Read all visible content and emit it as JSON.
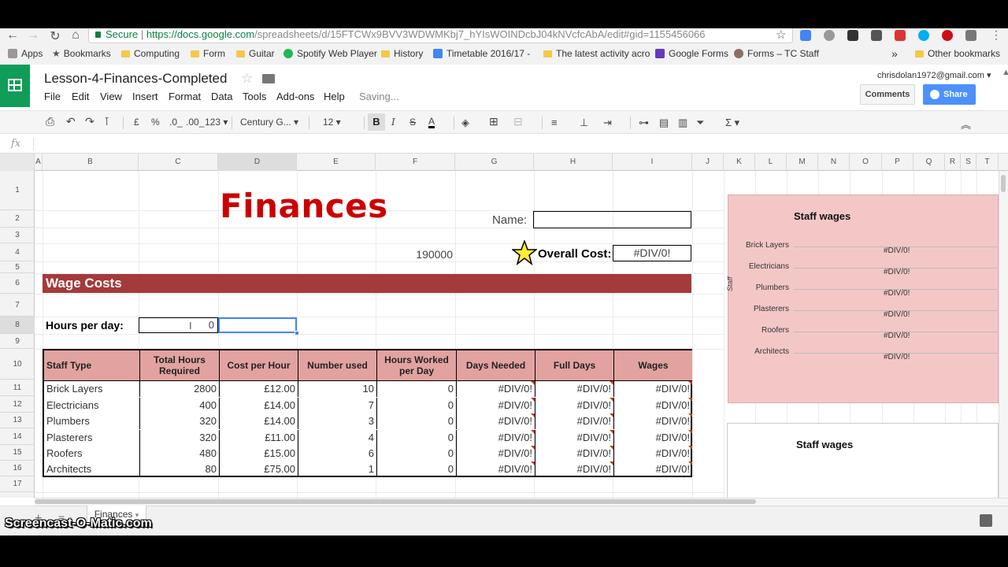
{
  "browser": {
    "secure_label": "Secure",
    "url_host": "https://docs.google.com",
    "url_path": "/spreadsheets/d/15FTCWx9BVV3WDWMKbj7_hYIsWOINDcbJ04kNVcfcAbA/edit#gid=1155456066",
    "bookmarks": [
      "Apps",
      "Bookmarks",
      "Computing",
      "Form",
      "Guitar",
      "Spotify Web Player",
      "History",
      "Timetable 2016/17 - ",
      "The latest activity acro",
      "Google Forms",
      "Forms – TC Staff",
      "Other bookmarks"
    ],
    "overflow": "»"
  },
  "doc": {
    "title": "Lesson-4-Finances-Completed",
    "account": "chrisdolan1972@gmail.com ▾",
    "comments": "Comments",
    "share": "Share",
    "saving": "Saving...",
    "menu": [
      "File",
      "Edit",
      "View",
      "Insert",
      "Format",
      "Data",
      "Tools",
      "Add-ons",
      "Help"
    ]
  },
  "toolbar": {
    "currency": "£",
    "percent": "%",
    "dec_less": ".0_",
    "dec_more": ".00_",
    "format": "123 ▾",
    "font": "Century G... ▾",
    "size": "12 ▾",
    "bold": "B",
    "italic": "I",
    "strike": "S",
    "textcolor": "A",
    "sigma": "Σ ▾"
  },
  "formula_bar": {
    "fx": "fx"
  },
  "columns": [
    "A",
    "B",
    "C",
    "D",
    "E",
    "F",
    "G",
    "H",
    "I",
    "J",
    "K",
    "L",
    "M",
    "N",
    "O",
    "P",
    "Q",
    "R",
    "S",
    "T"
  ],
  "rows": [
    "1",
    "2",
    "3",
    "4",
    "5",
    "6",
    "7",
    "8",
    "9",
    "10",
    "11",
    "12",
    "13",
    "14",
    "15",
    "16",
    "17"
  ],
  "sheet": {
    "heading": "Finances",
    "name_label": "Name:",
    "budget": "190000",
    "overall_label": "Overall Cost:",
    "overall_value": "#DIV/0!",
    "section": "Wage Costs",
    "hours_label": "Hours per day:",
    "hours_value": "0",
    "headers": [
      "Staff Type",
      "Total Hours Required",
      "Cost per Hour",
      "Number used",
      "Hours Worked per Day",
      "Days Needed",
      "Full Days",
      "Wages"
    ],
    "rows": [
      [
        "Brick Layers",
        "2800",
        "£12.00",
        "10",
        "0",
        "#DIV/0!",
        "#DIV/0!",
        "#DIV/0!"
      ],
      [
        "Electricians",
        "400",
        "£14.00",
        "7",
        "0",
        "#DIV/0!",
        "#DIV/0!",
        "#DIV/0!"
      ],
      [
        "Plumbers",
        "320",
        "£14.00",
        "3",
        "0",
        "#DIV/0!",
        "#DIV/0!",
        "#DIV/0!"
      ],
      [
        "Plasterers",
        "320",
        "£11.00",
        "4",
        "0",
        "#DIV/0!",
        "#DIV/0!",
        "#DIV/0!"
      ],
      [
        "Roofers",
        "480",
        "£15.00",
        "6",
        "0",
        "#DIV/0!",
        "#DIV/0!",
        "#DIV/0!"
      ],
      [
        "Architects",
        "80",
        "£75.00",
        "1",
        "0",
        "#DIV/0!",
        "#DIV/0!",
        "#DIV/0!"
      ]
    ]
  },
  "charts": {
    "chart1": {
      "title": "Staff wages",
      "axis_label": "Staff",
      "categories": [
        "Brick Layers",
        "Electricians",
        "Plumbers",
        "Plasterers",
        "Roofers",
        "Architects"
      ],
      "values": [
        "#DIV/0!",
        "#DIV/0!",
        "#DIV/0!",
        "#DIV/0!",
        "#DIV/0!",
        "#DIV/0!"
      ],
      "bg_color": "#f4c7c7"
    },
    "chart2": {
      "title": "Staff wages"
    }
  },
  "tabs": {
    "active": "Finances"
  },
  "watermark": "Screencast-O-Matic.com",
  "colors": {
    "sheets_green": "#0f9d58",
    "accent_red": "#cc0000",
    "band": "#a43a3a",
    "header_fill": "#e2a3a0",
    "share_blue": "#4d90fe"
  }
}
